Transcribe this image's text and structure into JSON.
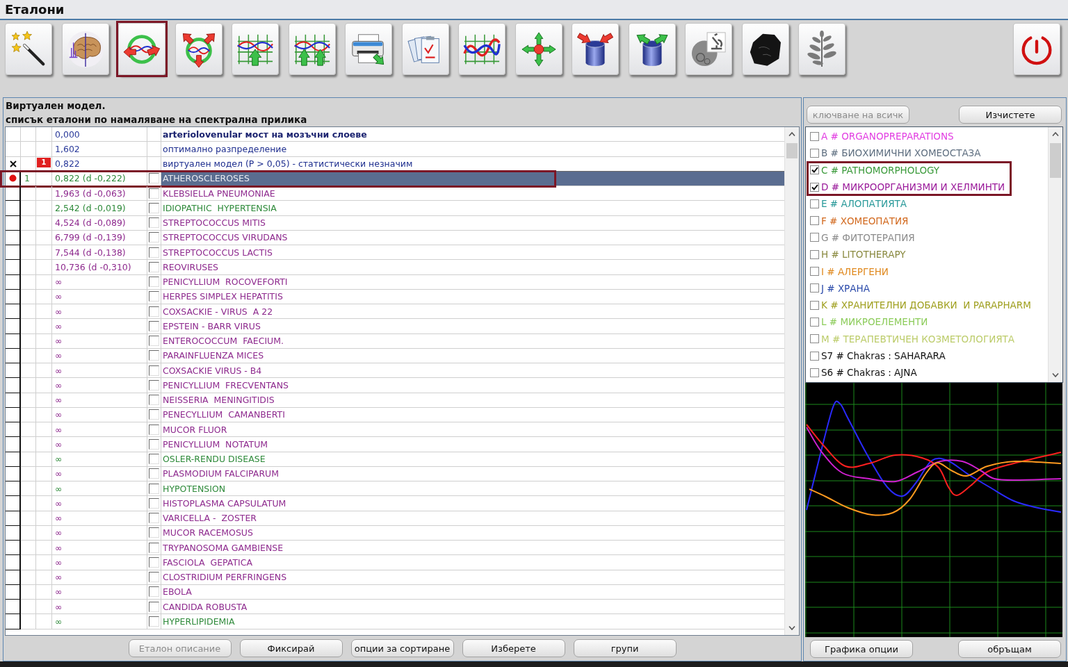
{
  "window": {
    "title": "Еталони"
  },
  "toolbar": {
    "tools": [
      {
        "kind": "wand",
        "highlighted": false
      },
      {
        "kind": "brain",
        "highlighted": false
      },
      {
        "kind": "ring",
        "highlighted": true
      },
      {
        "kind": "triad",
        "highlighted": false
      },
      {
        "kind": "raise",
        "highlighted": false
      },
      {
        "kind": "raise2",
        "highlighted": false
      },
      {
        "kind": "print",
        "highlighted": false
      },
      {
        "kind": "documents",
        "highlighted": false
      },
      {
        "kind": "curves",
        "highlighted": false
      },
      {
        "kind": "cross",
        "highlighted": false
      },
      {
        "kind": "absorb",
        "highlighted": false
      },
      {
        "kind": "emit",
        "highlighted": false
      },
      {
        "kind": "microscope",
        "highlighted": false
      },
      {
        "kind": "stone",
        "highlighted": false
      },
      {
        "kind": "plant",
        "highlighted": false
      },
      {
        "kind": "power",
        "highlighted": false
      }
    ]
  },
  "list_panel": {
    "captions": [
      "Виртуален модел.",
      "списък еталони по намаляване на спектрална прилика"
    ],
    "table": {
      "fixed_rows": [
        {
          "kind": "reference",
          "value": "0,000",
          "name": "arteriolovenular мост на мозъчни слоеве",
          "selected": false,
          "highlighted": false
        },
        {
          "kind": "model",
          "value": "1,602",
          "name": "оптимално разпределение",
          "selected": false,
          "highlighted": false
        },
        {
          "kind": "model",
          "marker": {
            "kind": "cross"
          },
          "badge": "1",
          "value": "0,822",
          "name": "виртуален модел (P > 0,05) - статистически незначим",
          "selected": false,
          "highlighted": false
        }
      ],
      "rows": [
        {
          "marker": {
            "kind": "dot"
          },
          "rank": "1",
          "value": "0,822 (d -0,222)",
          "name": "ATHEROSCLEROSES",
          "color": "#2e8a3a",
          "checked": false,
          "selected": true,
          "highlighted": true
        },
        {
          "value": "1,963 (d -0,063)",
          "name": "KLEBSIELLA PNEUMONIAE",
          "color": "#8e2a8e",
          "checked": false,
          "selected": false,
          "highlighted": false
        },
        {
          "value": "2,542 (d -0,019)",
          "name": "IDIOPATHIC  HYPERTENSIA",
          "color": "#2e8a3a",
          "checked": false,
          "selected": false,
          "highlighted": false
        },
        {
          "value": "4,524 (d -0,089)",
          "name": "STREPTOCOCCUS MITIS",
          "color": "#8e2a8e",
          "checked": false,
          "selected": false,
          "highlighted": false
        },
        {
          "value": "6,799 (d -0,139)",
          "name": "STREPTOCOCCUS VIRUDANS",
          "color": "#8e2a8e",
          "checked": false,
          "selected": false,
          "highlighted": false
        },
        {
          "value": "7,544 (d -0,138)",
          "name": "STREPTOCOCCUS LACTIS",
          "color": "#8e2a8e",
          "checked": false,
          "selected": false,
          "highlighted": false
        },
        {
          "value": "10,736 (d -0,310)",
          "name": "REOVIRUSES",
          "color": "#8e2a8e",
          "checked": false,
          "selected": false,
          "highlighted": false
        },
        {
          "value": "∞",
          "name": "PENICYLLIUM  ROCOVEFORTI",
          "color": "#8e2a8e",
          "checked": false,
          "selected": false,
          "highlighted": false
        },
        {
          "value": "∞",
          "name": "HERPES SIMPLEX HEPATITIS",
          "color": "#8e2a8e",
          "checked": false,
          "selected": false,
          "highlighted": false
        },
        {
          "value": "∞",
          "name": "COXSACKIE - VIRUS  A 22",
          "color": "#8e2a8e",
          "checked": false,
          "selected": false,
          "highlighted": false
        },
        {
          "value": "∞",
          "name": "EPSTEIN - BARR VIRUS",
          "color": "#8e2a8e",
          "checked": false,
          "selected": false,
          "highlighted": false
        },
        {
          "value": "∞",
          "name": "ENTEROCOCCUM  FAECIUM.",
          "color": "#8e2a8e",
          "checked": false,
          "selected": false,
          "highlighted": false
        },
        {
          "value": "∞",
          "name": "PARAINFLUENZA MICES",
          "color": "#8e2a8e",
          "checked": false,
          "selected": false,
          "highlighted": false
        },
        {
          "value": "∞",
          "name": "COXSACKIE VIRUS - B4",
          "color": "#8e2a8e",
          "checked": false,
          "selected": false,
          "highlighted": false
        },
        {
          "value": "∞",
          "name": "PENICYLLIUM  FRECVENTANS",
          "color": "#8e2a8e",
          "checked": false,
          "selected": false,
          "highlighted": false
        },
        {
          "value": "∞",
          "name": "NEISSERIA  MENINGITIDIS",
          "color": "#8e2a8e",
          "checked": false,
          "selected": false,
          "highlighted": false
        },
        {
          "value": "∞",
          "name": "PENECYLLIUM  CAMANBERTI",
          "color": "#8e2a8e",
          "checked": false,
          "selected": false,
          "highlighted": false
        },
        {
          "value": "∞",
          "name": "MUCOR FLUOR",
          "color": "#8e2a8e",
          "checked": false,
          "selected": false,
          "highlighted": false
        },
        {
          "value": "∞",
          "name": "PENICYLLIUM  NOTATUM",
          "color": "#8e2a8e",
          "checked": false,
          "selected": false,
          "highlighted": false
        },
        {
          "value": "∞",
          "name": "OSLER-RENDU DISEASE",
          "color": "#2e8a3a",
          "checked": false,
          "selected": false,
          "highlighted": false
        },
        {
          "value": "∞",
          "name": "PLASMODIUM FALCIPARUM",
          "color": "#8e2a8e",
          "checked": false,
          "selected": false,
          "highlighted": false
        },
        {
          "value": "∞",
          "name": "HYPOTENSION",
          "color": "#2e8a3a",
          "checked": false,
          "selected": false,
          "highlighted": false
        },
        {
          "value": "∞",
          "name": "HISTOPLASMA CAPSULATUM",
          "color": "#8e2a8e",
          "checked": false,
          "selected": false,
          "highlighted": false
        },
        {
          "value": "∞",
          "name": "VARICELLA -  ZOSTER",
          "color": "#8e2a8e",
          "checked": false,
          "selected": false,
          "highlighted": false
        },
        {
          "value": "∞",
          "name": "MUCOR RACEMOSUS",
          "color": "#8e2a8e",
          "checked": false,
          "selected": false,
          "highlighted": false
        },
        {
          "value": "∞",
          "name": "TRYPANOSOMA GAMBIENSE",
          "color": "#8e2a8e",
          "checked": false,
          "selected": false,
          "highlighted": false
        },
        {
          "value": "∞",
          "name": "FASCIOLA  GEPATICA",
          "color": "#8e2a8e",
          "checked": false,
          "selected": false,
          "highlighted": false
        },
        {
          "value": "∞",
          "name": "CLOSTRIDIUM PERFRINGENS",
          "color": "#8e2a8e",
          "checked": false,
          "selected": false,
          "highlighted": false
        },
        {
          "value": "∞",
          "name": "EBOLA",
          "color": "#8e2a8e",
          "checked": false,
          "selected": false,
          "highlighted": false
        },
        {
          "value": "∞",
          "name": "CANDIDA ROBUSTA",
          "color": "#8e2a8e",
          "checked": false,
          "selected": false,
          "highlighted": false
        },
        {
          "value": "∞",
          "name": "HYPERLIPIDEMIA",
          "color": "#2e8a3a",
          "checked": false,
          "selected": false,
          "highlighted": false
        }
      ]
    },
    "buttons": [
      {
        "label": "Еталон описание",
        "disabled": true
      },
      {
        "label": "Фиксирай",
        "disabled": false
      },
      {
        "label": "опции за сортиране",
        "disabled": false
      },
      {
        "label": "Изберете",
        "disabled": false
      },
      {
        "label": "групи",
        "disabled": false
      }
    ]
  },
  "category_panel": {
    "buttons": [
      {
        "label": "ключване на всичк",
        "disabled": true
      },
      {
        "label": "Изчистете",
        "disabled": false
      }
    ],
    "categories": [
      {
        "label": "A # ORGANOPREPARATIONS",
        "color": "#e23ee2",
        "checked": false,
        "highlighted": false
      },
      {
        "label": "B # БИОХИМИЧНИ ХОМЕОСТАЗА",
        "color": "#5f6f80",
        "checked": false,
        "highlighted": false
      },
      {
        "label": "C # PATHOMORPHOLOGY",
        "color": "#3a9a3a",
        "checked": true,
        "highlighted": true
      },
      {
        "label": "D # МИКРООРГАНИЗМИ И ХЕЛМИНТИ",
        "color": "#9a1a9a",
        "checked": true,
        "highlighted": true
      },
      {
        "label": "E # АЛОПАТИЯТА",
        "color": "#2a9a9a",
        "checked": false,
        "highlighted": false
      },
      {
        "label": "F # ХОМЕОПАТИЯ",
        "color": "#d2691e",
        "checked": false,
        "highlighted": false
      },
      {
        "label": "G # ФИТОТЕРАПИЯ",
        "color": "#8c8c8c",
        "checked": false,
        "highlighted": false
      },
      {
        "label": "H # LITOTHERAPY",
        "color": "#8a8a40",
        "checked": false,
        "highlighted": false
      },
      {
        "label": "I # АЛЕРГЕНИ",
        "color": "#e08a20",
        "checked": false,
        "highlighted": false
      },
      {
        "label": "J # ХРАНА",
        "color": "#2a4aaa",
        "checked": false,
        "highlighted": false
      },
      {
        "label": "K # ХРАНИТЕЛНИ ДОБАВКИ  И PARAPHARM",
        "color": "#a0a020",
        "checked": false,
        "highlighted": false
      },
      {
        "label": "L # МИКРОЕЛЕМЕНТИ",
        "color": "#8ccc5a",
        "checked": false,
        "highlighted": false
      },
      {
        "label": "M # ТЕРАПЕВТИЧЕН КОЗМЕТОЛОГИЯТА",
        "color": "#bccc6a",
        "checked": false,
        "highlighted": false
      },
      {
        "label": "S7 # Chakras : SAHARARA",
        "color": "#111111",
        "checked": false,
        "highlighted": false
      },
      {
        "label": "S6 # Chakras : AJNA",
        "color": "#111111",
        "checked": false,
        "highlighted": false
      }
    ],
    "bottom_buttons": [
      {
        "label": "Графика опции",
        "disabled": false
      },
      {
        "label": "обръщам",
        "disabled": false
      }
    ]
  }
}
